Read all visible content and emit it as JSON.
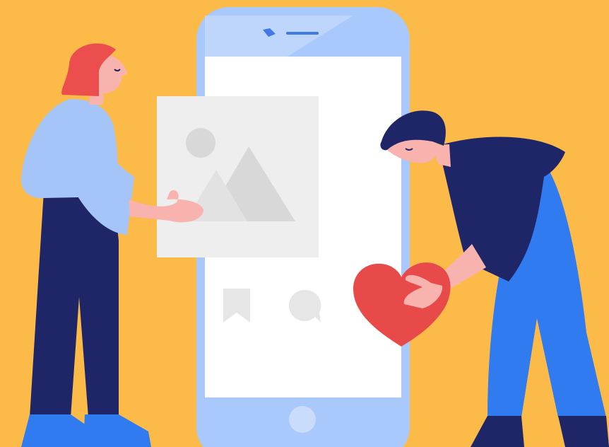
{
  "colors": {
    "background": "#FCBB49",
    "phone_body": "#A9C8FB",
    "phone_highlight": "#C3D8FC",
    "screen": "#FFFFFF",
    "card": "#EEEEEE",
    "card_shapes": "#D8D8D8",
    "icon_gray": "#E6E6E6",
    "heart": "#E84A4A",
    "woman_hair": "#EC4E4E",
    "woman_top": "#A5C4F8",
    "woman_pants": "#1F2668",
    "woman_shoes": "#2F7BEF",
    "skin": "#F8B3AF",
    "man_hair": "#1F2668",
    "man_top": "#1F2668",
    "man_pants": "#2F7BEF",
    "man_shoes": "#1F2668"
  },
  "icons": [
    "image-icon",
    "bookmark-icon",
    "comment-icon",
    "heart-icon"
  ]
}
